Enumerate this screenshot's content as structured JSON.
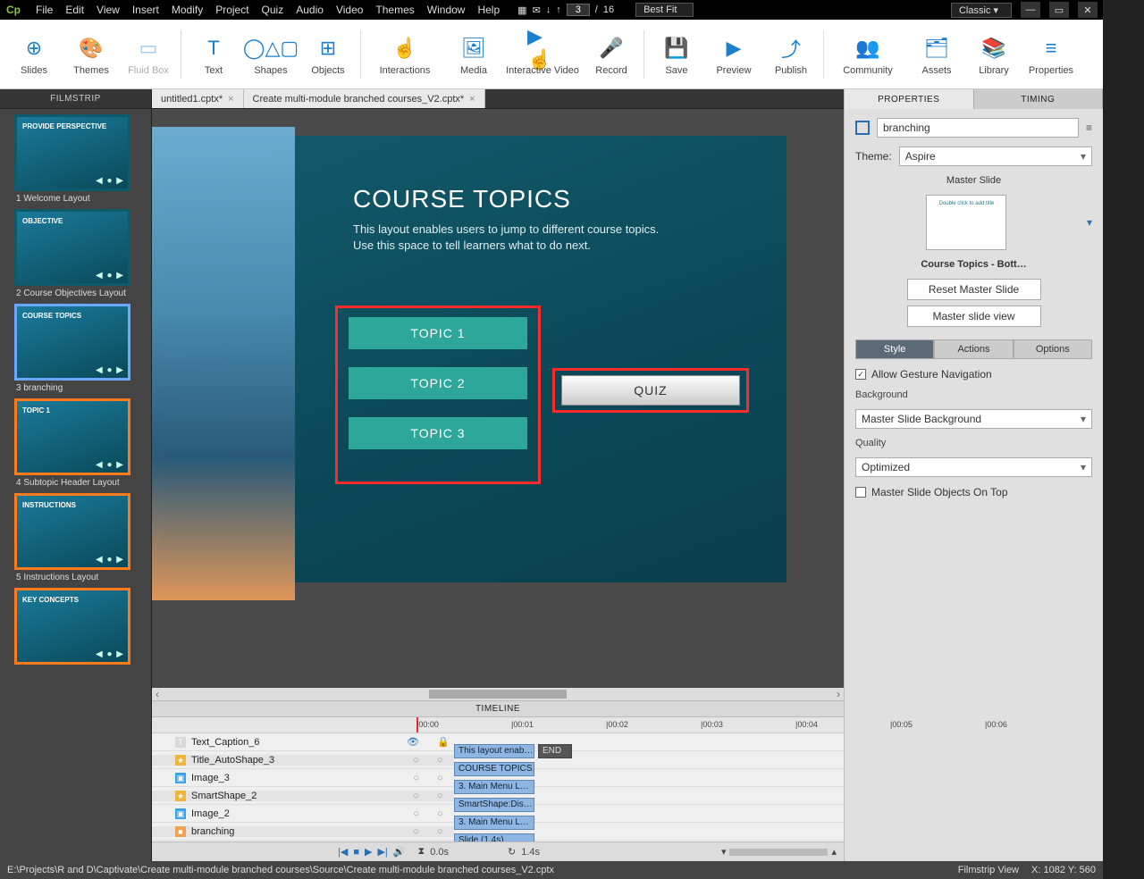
{
  "menubar": [
    "File",
    "Edit",
    "View",
    "Insert",
    "Modify",
    "Project",
    "Quiz",
    "Audio",
    "Video",
    "Themes",
    "Window",
    "Help"
  ],
  "slide_counter": {
    "current": "3",
    "sep": "/",
    "total": "16"
  },
  "zoom": "Best Fit",
  "workspace": "Classic",
  "ribbon": [
    {
      "label": "Slides"
    },
    {
      "label": "Themes"
    },
    {
      "label": "Fluid Box"
    },
    {
      "sep": true
    },
    {
      "label": "Text"
    },
    {
      "label": "Shapes"
    },
    {
      "label": "Objects"
    },
    {
      "sep": true
    },
    {
      "label": "Interactions"
    },
    {
      "label": "Media"
    },
    {
      "label": "Interactive Video"
    },
    {
      "label": "Record"
    },
    {
      "sep": true
    },
    {
      "label": "Save"
    },
    {
      "label": "Preview"
    },
    {
      "label": "Publish"
    },
    {
      "sep": true
    },
    {
      "label": "Community"
    },
    {
      "label": "Assets"
    },
    {
      "label": "Library"
    },
    {
      "label": "Properties"
    }
  ],
  "filmstrip": {
    "title": "FILMSTRIP",
    "items": [
      {
        "caption": "1 Welcome Layout",
        "text": "PROVIDE PERSPECTIVE"
      },
      {
        "caption": "2 Course Objectives Layout",
        "text": "OBJECTIVE"
      },
      {
        "caption": "3 branching",
        "text": "COURSE TOPICS",
        "selected": true
      },
      {
        "caption": "4 Subtopic Header Layout",
        "text": "TOPIC 1",
        "marked": true
      },
      {
        "caption": "5 Instructions Layout",
        "text": "INSTRUCTIONS",
        "marked": true
      },
      {
        "caption": "",
        "text": "KEY CONCEPTS",
        "marked": true
      }
    ]
  },
  "tabs": [
    {
      "label": "untitled1.cptx*"
    },
    {
      "label": "Create multi-module branched courses_V2.cptx*"
    }
  ],
  "canvas": {
    "title": "COURSE TOPICS",
    "desc": "This layout enables users to jump to different course topics. Use this space to tell learners what to do next.",
    "topics": [
      "TOPIC 1",
      "TOPIC 2",
      "TOPIC 3"
    ],
    "quiz": "QUIZ"
  },
  "timeline": {
    "title": "TIMELINE",
    "ticks": [
      "|00:00",
      "|00:01",
      "|00:02",
      "|00:03",
      "|00:04",
      "|00:05",
      "|00:06"
    ],
    "layers": [
      {
        "name": "Text_Caption_6",
        "seg": "This layout enab…",
        "end": "END",
        "icon": "T",
        "iconbg": "#d8d8d8"
      },
      {
        "name": "Title_AutoShape_3",
        "seg": "COURSE TOPICS…",
        "icon": "★",
        "iconbg": "#f3b23a"
      },
      {
        "name": "Image_3",
        "seg": "3. Main Menu L…",
        "icon": "▣",
        "iconbg": "#3aa0e8"
      },
      {
        "name": "SmartShape_2",
        "seg": "SmartShape:Dis…",
        "icon": "★",
        "iconbg": "#f3b23a"
      },
      {
        "name": "Image_2",
        "seg": "3. Main Menu L…",
        "icon": "▣",
        "iconbg": "#3aa0e8"
      },
      {
        "name": "branching",
        "seg": "Slide (1.4s)",
        "icon": "■",
        "iconbg": "#f0a050",
        "slide": true
      }
    ],
    "ctrl": {
      "time": "0.0s",
      "dur": "1.4s"
    }
  },
  "props": {
    "tab_properties": "PROPERTIES",
    "tab_timing": "TIMING",
    "name": "branching",
    "theme_label": "Theme:",
    "theme_value": "Aspire",
    "master_slide_heading": "Master Slide",
    "master_slide_thumb_text": "Double click to add title",
    "master_slide_name": "Course Topics - Bott…",
    "reset_btn": "Reset Master Slide",
    "view_btn": "Master slide view",
    "subtab_style": "Style",
    "subtab_actions": "Actions",
    "subtab_options": "Options",
    "allow_gesture": "Allow Gesture Navigation",
    "background_label": "Background",
    "background_value": "Master Slide Background",
    "quality_label": "Quality",
    "quality_value": "Optimized",
    "ms_ontop": "Master Slide Objects On Top"
  },
  "statusbar": {
    "path": "E:\\Projects\\R and D\\Captivate\\Create multi-module branched courses\\Source\\Create multi-module branched courses_V2.cptx",
    "view": "Filmstrip View",
    "coords": "X: 1082 Y: 560"
  }
}
